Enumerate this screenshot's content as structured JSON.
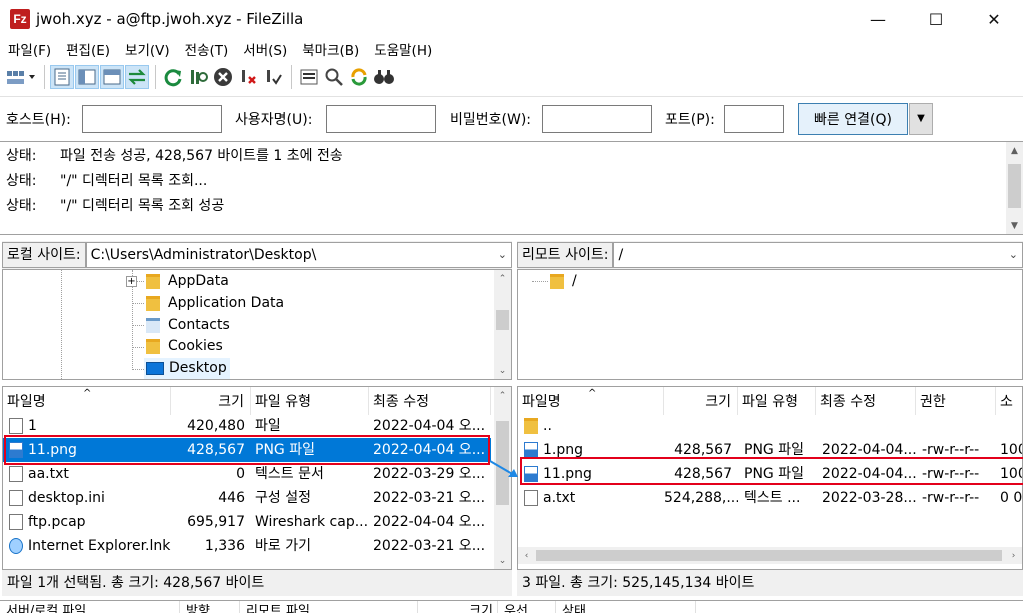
{
  "window": {
    "title": "jwoh.xyz - a@ftp.jwoh.xyz - FileZilla",
    "app_icon": "Fz"
  },
  "menu": [
    "파일(F)",
    "편집(E)",
    "보기(V)",
    "전송(T)",
    "서버(S)",
    "북마크(B)",
    "도움말(H)"
  ],
  "quickconnect": {
    "host_label": "호스트(H):",
    "user_label": "사용자명(U):",
    "pass_label": "비밀번호(W):",
    "port_label": "포트(P):",
    "connect_label": "빠른 연결(Q)"
  },
  "log": [
    {
      "type": "상태:",
      "msg": "파일 전송 성공, 428,567 바이트를 1 초에 전송"
    },
    {
      "type": "상태:",
      "msg": "\"/\" 디렉터리 목록 조회..."
    },
    {
      "type": "상태:",
      "msg": "\"/\" 디렉터리 목록 조회 성공"
    }
  ],
  "local": {
    "site_label": "로컬 사이트:",
    "path": "C:\\Users\\Administrator\\Desktop\\",
    "tree": [
      "AppData",
      "Application Data",
      "Contacts",
      "Cookies",
      "Desktop"
    ],
    "headers": {
      "name": "파일명",
      "size": "크기",
      "type": "파일 유형",
      "modified": "최종 수정"
    },
    "files": [
      {
        "name": "1",
        "size": "420,480",
        "type": "파일",
        "modified": "2022-04-04 오..."
      },
      {
        "name": "11.png",
        "size": "428,567",
        "type": "PNG 파일",
        "modified": "2022-04-04 오..."
      },
      {
        "name": "aa.txt",
        "size": "0",
        "type": "텍스트 문서",
        "modified": "2022-03-29 오..."
      },
      {
        "name": "desktop.ini",
        "size": "446",
        "type": "구성 설정",
        "modified": "2022-03-21 오..."
      },
      {
        "name": "ftp.pcap",
        "size": "695,917",
        "type": "Wireshark cap...",
        "modified": "2022-04-04 오..."
      },
      {
        "name": "Internet Explorer.lnk",
        "size": "1,336",
        "type": "바로 가기",
        "modified": "2022-03-21 오..."
      }
    ],
    "status": "파일 1개 선택됨. 총 크기: 428,567 바이트"
  },
  "remote": {
    "site_label": "리모트 사이트:",
    "path": "/",
    "tree": [
      "/"
    ],
    "headers": {
      "name": "파일명",
      "size": "크기",
      "type": "파일 유형",
      "modified": "최종 수정",
      "perm": "권한",
      "owner": "소유"
    },
    "files": [
      {
        "name": "..",
        "size": "",
        "type": "",
        "modified": "",
        "perm": "",
        "owner": ""
      },
      {
        "name": "1.png",
        "size": "428,567",
        "type": "PNG 파일",
        "modified": "2022-04-04...",
        "perm": "-rw-r--r--",
        "owner": "100"
      },
      {
        "name": "11.png",
        "size": "428,567",
        "type": "PNG 파일",
        "modified": "2022-04-04...",
        "perm": "-rw-r--r--",
        "owner": "100"
      },
      {
        "name": "a.txt",
        "size": "524,288,...",
        "type": "텍스트 ...",
        "modified": "2022-03-28...",
        "perm": "-rw-r--r--",
        "owner": "0 0"
      }
    ],
    "status": "3 파일. 총 크기: 525,145,134 바이트"
  },
  "queue_headers": [
    "서버/로컬 파일",
    "방향",
    "리모트 파일",
    "크기",
    "우선",
    "상태"
  ]
}
